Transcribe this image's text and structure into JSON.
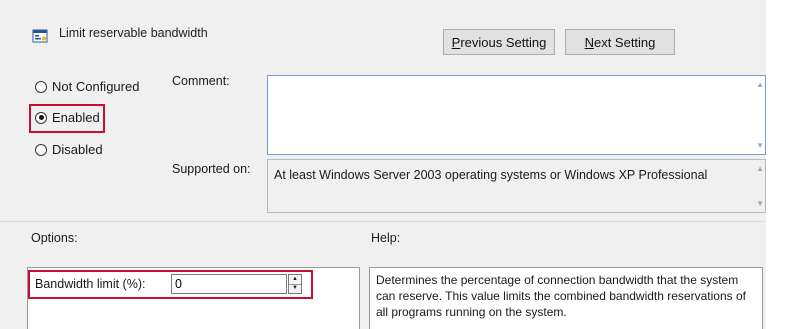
{
  "window": {
    "title": "Limit reservable bandwidth"
  },
  "nav": {
    "previous_label": "Previous Setting",
    "previous_rest": "revious Setting",
    "previous_mnemonic": "P",
    "next_label": "Next Setting",
    "next_rest": "ext Setting",
    "next_mnemonic": "N"
  },
  "state": {
    "options": [
      {
        "key": "not_configured",
        "label": "Not Configured",
        "checked": false
      },
      {
        "key": "enabled",
        "label": "Enabled",
        "checked": true
      },
      {
        "key": "disabled",
        "label": "Disabled",
        "checked": false
      }
    ],
    "not_configured_label": "Not Configured",
    "enabled_label": "Enabled",
    "disabled_label": "Disabled"
  },
  "comment": {
    "label": "Comment:",
    "value": ""
  },
  "supported": {
    "label": "Supported on:",
    "value": "At least Windows Server 2003 operating systems or Windows XP Professional"
  },
  "options_section": {
    "label": "Options:",
    "bandwidth_label": "Bandwidth limit (%):",
    "bandwidth_value": "0"
  },
  "help_section": {
    "label": "Help:",
    "text": "Determines the percentage of connection bandwidth that the system can reserve. This value limits the combined bandwidth reservations of all programs running on the system."
  },
  "colors": {
    "highlight": "#c8102e",
    "dialog_bg": "#f0f0f0",
    "button_bg": "#e1e1e1"
  }
}
